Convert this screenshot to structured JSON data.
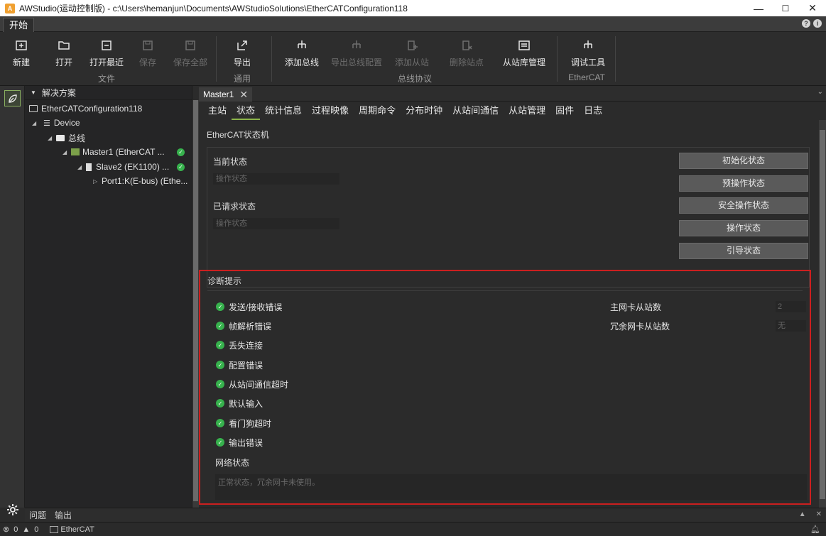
{
  "window": {
    "title": "AWStudio(运动控制版) - c:\\Users\\hemanjun\\Documents\\AWStudioSolutions\\EtherCATConfiguration118",
    "minimize": "—",
    "maximize": "☐",
    "close": "✕"
  },
  "menu": {
    "tab": "开始"
  },
  "ribbon": {
    "new": "新建",
    "open": "打开",
    "open_recent": "打开最近",
    "save": "保存",
    "save_all": "保存全部",
    "file_group": "文件",
    "export": "导出",
    "general_group": "通用",
    "add_bus": "添加总线",
    "export_bus_config": "导出总线配置",
    "add_slave": "添加从站",
    "delete_station": "删除站点",
    "slave_lib_mgmt": "从站库管理",
    "bus_protocol_group": "总线协议",
    "debug_tool": "调试工具",
    "ethercat_group": "EtherCAT"
  },
  "solution": {
    "header": "解决方案",
    "root": "EtherCATConfiguration118",
    "device": "Device",
    "bus": "总线",
    "master": "Master1 (EtherCAT ...",
    "slave": "Slave2 (EK1100) ...",
    "port": "Port1:K(E-bus) (Ethe..."
  },
  "doc": {
    "tab": "Master1",
    "tab_close": "✕",
    "sub_tabs": [
      "主站",
      "状态",
      "统计信息",
      "过程映像",
      "周期命令",
      "分布时钟",
      "从站间通信",
      "从站管理",
      "固件",
      "日志"
    ]
  },
  "state_machine": {
    "title": "EtherCAT状态机",
    "current_label": "当前状态",
    "current_value": "操作状态",
    "requested_label": "已请求状态",
    "requested_value": "操作状态",
    "buttons": [
      "初始化状态",
      "预操作状态",
      "安全操作状态",
      "操作状态",
      "引导状态"
    ]
  },
  "diagnostics": {
    "title": "诊断提示",
    "items": [
      "发送/接收错误",
      "帧解析错误",
      "丢失连接",
      "配置错误",
      "从站间通信超时",
      "默认输入",
      "看门狗超时",
      "输出错误"
    ],
    "main_nic_label": "主网卡从站数",
    "main_nic_value": "2",
    "redundant_nic_label": "冗余网卡从站数",
    "redundant_nic_value": "无",
    "network_label": "网络状态",
    "network_value": "正常状态，冗余网卡未使用。"
  },
  "bottom": {
    "issues": "问题",
    "output": "输出"
  },
  "status": {
    "errors": "0",
    "warnings": "0",
    "ethercat": "EtherCAT"
  },
  "colors": {
    "accent": "#8cb44a",
    "ok": "#37b24d",
    "highlight": "#cc1f1f"
  }
}
